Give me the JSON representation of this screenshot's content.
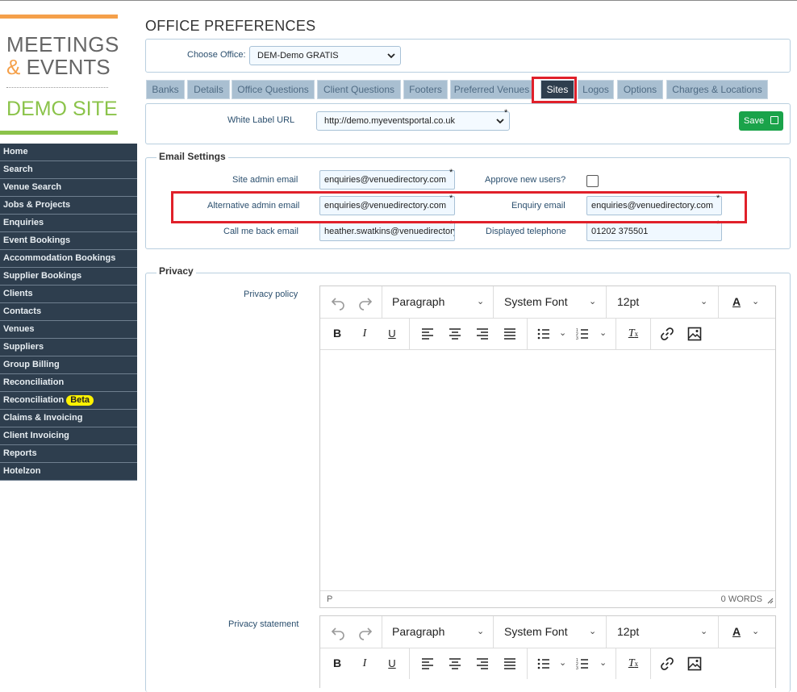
{
  "brand": {
    "line1": "MEETINGS",
    "amp": "&",
    "line2": " EVENTS",
    "line3": "DEMO SITE",
    "accent_orange": "#f5a04a",
    "accent_green": "#8bc34a"
  },
  "sidebar": {
    "items": [
      {
        "label": "Home"
      },
      {
        "label": "Search"
      },
      {
        "label": "Venue Search"
      },
      {
        "label": "Jobs & Projects"
      },
      {
        "label": "Enquiries"
      },
      {
        "label": "Event Bookings"
      },
      {
        "label": "Accommodation Bookings"
      },
      {
        "label": "Supplier Bookings"
      },
      {
        "label": "Clients"
      },
      {
        "label": "Contacts"
      },
      {
        "label": "Venues"
      },
      {
        "label": "Suppliers"
      },
      {
        "label": "Group Billing"
      },
      {
        "label": "Reconciliation"
      },
      {
        "label": "Reconciliation",
        "badge": "Beta"
      },
      {
        "label": "Claims & Invoicing"
      },
      {
        "label": "Client Invoicing"
      },
      {
        "label": "Reports"
      },
      {
        "label": "Hotelzon"
      }
    ]
  },
  "page_title": "OFFICE PREFERENCES",
  "office": {
    "label": "Choose Office:",
    "value": "DEM-Demo GRATIS"
  },
  "tabs": [
    "Banks",
    "Details",
    "Office Questions",
    "Client Questions",
    "Footers",
    "Preferred Venues",
    "Sites",
    "Logos",
    "Options",
    "Charges & Locations"
  ],
  "active_tab": "Sites",
  "sites": {
    "white_label_label": "White Label URL",
    "white_label_value": "http://demo.myeventsportal.co.uk",
    "save_label": "Save"
  },
  "email_settings": {
    "legend": "Email Settings",
    "site_admin_label": "Site admin email",
    "site_admin_value": "enquiries@venuedirectory.com",
    "approve_label": "Approve new users?",
    "alt_admin_label": "Alternative admin email",
    "alt_admin_value": "enquiries@venuedirectory.com",
    "enquiry_label": "Enquiry email",
    "enquiry_value": "enquiries@venuedirectory.com",
    "call_back_label": "Call me back email",
    "call_back_value": "heather.swatkins@venuedirectory",
    "telephone_label": "Displayed telephone",
    "telephone_value": "01202 375501"
  },
  "privacy": {
    "legend": "Privacy",
    "policy_label": "Privacy policy",
    "statement_label": "Privacy statement",
    "editor": {
      "block": "Paragraph",
      "font": "System Font",
      "size": "12pt",
      "path": "P",
      "words": "0 WORDS"
    }
  },
  "required_mark": "*",
  "highlight_color": "#e0202a"
}
